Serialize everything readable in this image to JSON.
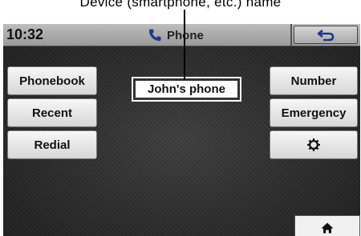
{
  "callout_text": "Device (smartphone, etc.) name",
  "status_bar": {
    "time": "10:32",
    "title": "Phone",
    "phone_icon": "phone-handset-icon",
    "back_icon": "back-arrow-icon"
  },
  "contact": {
    "name": "John's phone"
  },
  "left_buttons": [
    {
      "label": "Phonebook"
    },
    {
      "label": "Recent"
    },
    {
      "label": "Redial"
    }
  ],
  "right_buttons": [
    {
      "label": "Number"
    },
    {
      "label": "Emergency"
    },
    {
      "label": "",
      "icon": "gear-icon"
    }
  ],
  "home": {
    "icon": "home-icon"
  }
}
